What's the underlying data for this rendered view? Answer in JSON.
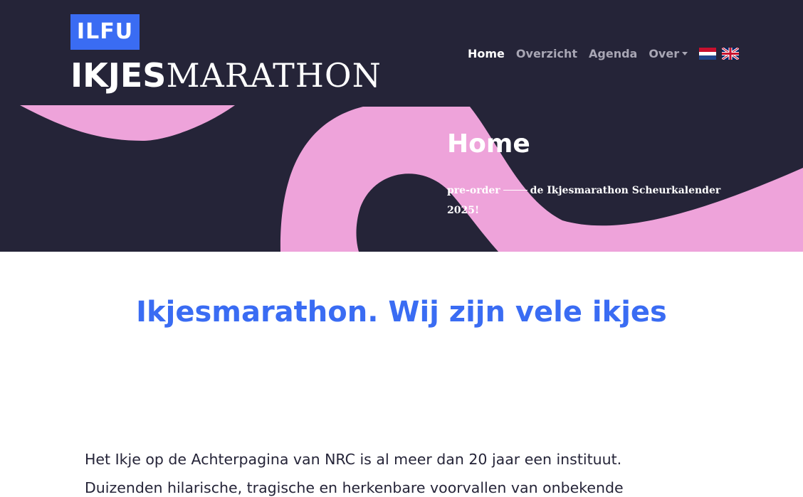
{
  "brand": {
    "badge_text": "ILFU",
    "title_bold": "IKJES",
    "title_serif": "MARATHON",
    "badge_color": "#3a6cf3"
  },
  "nav": {
    "items": [
      {
        "label": "Home",
        "active": true
      },
      {
        "label": "Overzicht",
        "active": false
      },
      {
        "label": "Agenda",
        "active": false
      },
      {
        "label": "Over",
        "active": false,
        "dropdown": true
      }
    ],
    "flags": [
      "netherlands-flag-icon",
      "uk-flag-icon"
    ]
  },
  "hero": {
    "title": "Home",
    "subtitle_before": "pre-order",
    "subtitle_after": "de Ikjesmarathon Scheurkalender 2025!",
    "background_color": "#252438",
    "accent_color": "#eea3da"
  },
  "main": {
    "heading": "Ikjesmarathon. Wij zijn vele ikjes",
    "intro": "Het Ikje op de Achterpagina van NRC is al meer dan 20 jaar een instituut. Duizenden hilarische, tragische en herkenbare voorvallen van onbekende"
  }
}
